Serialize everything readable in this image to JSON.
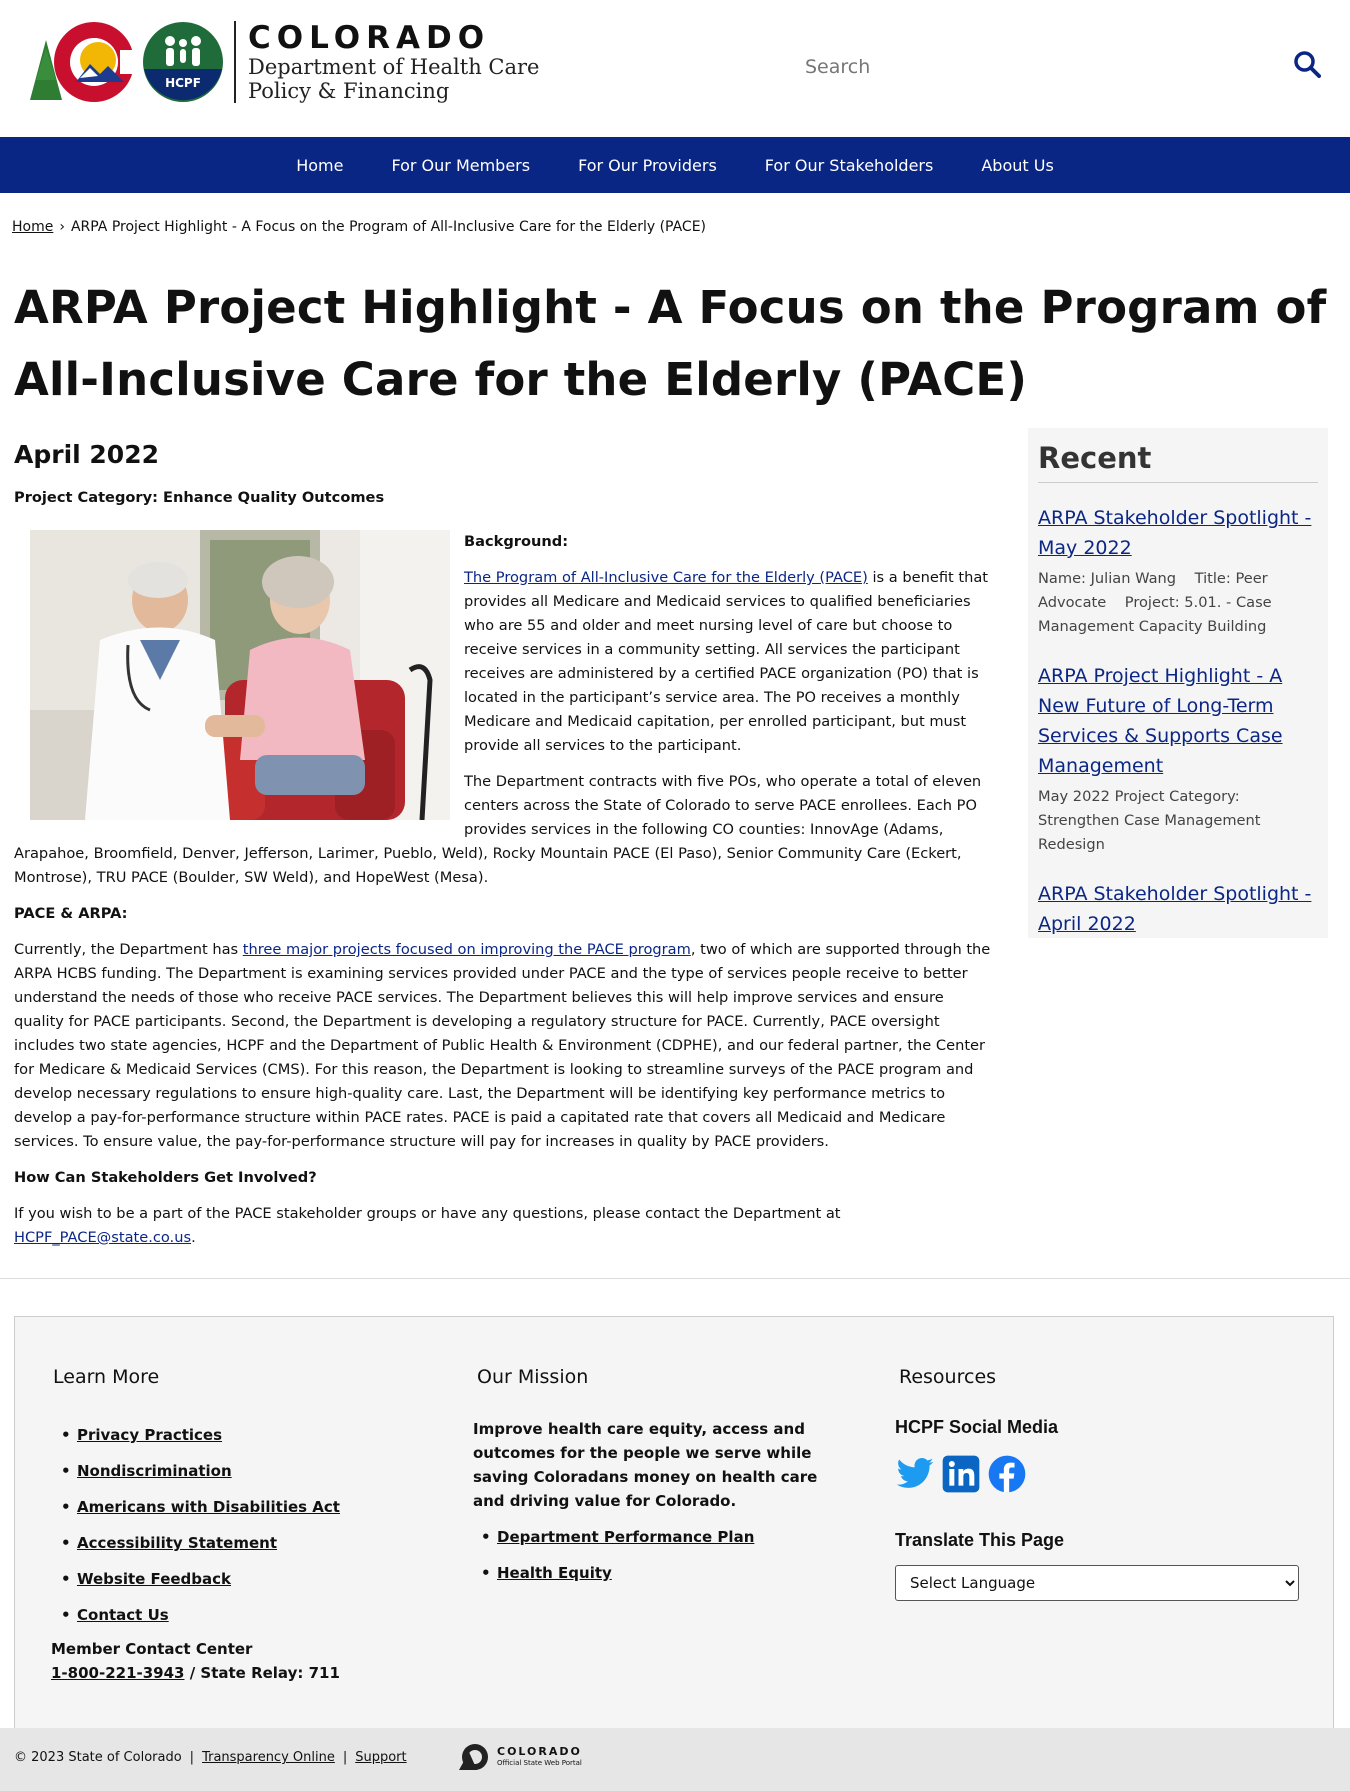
{
  "header": {
    "logo_state": "COLORADO",
    "logo_dept_line1": "Department of Health Care",
    "logo_dept_line2": "Policy & Financing",
    "hcpf_badge": "HCPF",
    "search_placeholder": "Search"
  },
  "nav": {
    "items": [
      {
        "label": "Home"
      },
      {
        "label": "For Our Members"
      },
      {
        "label": "For Our Providers"
      },
      {
        "label": "For Our Stakeholders"
      },
      {
        "label": "About Us"
      }
    ]
  },
  "breadcrumb": {
    "home": "Home",
    "separator": "›",
    "current": "ARPA Project Highlight - A Focus on the Program of All-Inclusive Care for the Elderly (PACE)"
  },
  "page": {
    "title": "ARPA Project Highlight - A Focus on the Program of All-Inclusive Care for the Elderly (PACE)",
    "date": "April 2022",
    "category": "Project Category: Enhance Quality Outcomes",
    "background_label": "Background:",
    "pace_link": "The Program of All-Inclusive Care for the Elderly (PACE)",
    "para1_rest": " is a benefit that provides all Medicare and Medicaid services to qualified beneficiaries who are 55 and older and meet nursing level of care but choose to receive services in a community setting. All services the participant receives are administered by a certified PACE organization (PO) that is located in the participant’s service area. The PO receives a monthly Medicare and Medicaid capitation, per enrolled participant, but must provide all services to the participant.",
    "para2": "The Department contracts with five POs, who operate a total of eleven centers across the State of Colorado to serve PACE enrollees. Each PO provides services in the following CO counties: InnovAge (Adams, Arapahoe, Broomfield, Denver, Jefferson, Larimer, Pueblo, Weld), Rocky Mountain PACE (El Paso), Senior Community Care (Eckert, Montrose), TRU PACE (Boulder, SW Weld), and HopeWest (Mesa).",
    "arpa_label": "PACE & ARPA:",
    "para3_start": "Currently, the Department has ",
    "projects_link": "three major projects focused on improving the PACE program",
    "para3_rest": ", two of which are supported through the ARPA HCBS funding. The Department is examining services provided under PACE and the type of services people receive to better understand the needs of those who receive PACE services. The Department believes this will help improve services and ensure quality for PACE participants. Second, the Department is developing a regulatory structure for PACE. Currently, PACE oversight includes two state agencies, HCPF and the Department of Public Health & Environment (CDPHE), and our federal partner, the Center for Medicare & Medicaid Services (CMS). For this reason, the Department is looking to streamline surveys of the PACE program and develop necessary regulations to ensure high-quality care. Last, the Department will be identifying key performance metrics to develop a pay-for-performance structure within PACE rates. PACE is paid a capitated rate that covers all Medicaid and Medicare services. To ensure value, the pay-for-performance structure will pay for increases in quality by PACE providers.",
    "involved_label": "How Can Stakeholders Get Involved?",
    "para4_start": "If you wish to be a part of the PACE stakeholder groups or have any questions, please contact the Department at ",
    "email": "HCPF_PACE@state.co.us",
    "para4_end": "."
  },
  "sidebar": {
    "title": "Recent",
    "items": [
      {
        "link": "ARPA Stakeholder Spotlight - May 2022",
        "meta": "Name: Julian Wang    Title: Peer Advocate    Project: 5.01. - Case Management Capacity Building"
      },
      {
        "link": "ARPA Project Highlight - A New Future of Long-Term Services & Supports Case Management",
        "meta": "May 2022 Project Category: Strengthen Case Management Redesign"
      },
      {
        "link": "ARPA Stakeholder Spotlight - April 2022",
        "meta": ""
      }
    ]
  },
  "footer": {
    "learn_more": {
      "title": "Learn More",
      "links": [
        "Privacy Practices",
        "Nondiscrimination",
        "Americans with Disabilities Act",
        "Accessibility Statement",
        "Website Feedback",
        "Contact Us"
      ]
    },
    "member": {
      "label": "Member Contact Center",
      "phone": "1-800-221-3943",
      "relay": " / State Relay: 711"
    },
    "mission": {
      "title": "Our Mission",
      "text": "Improve health care equity, access and outcomes for the people we serve while saving Coloradans money on health care and driving value for Colorado.",
      "links": [
        "Department Performance Plan",
        "Health Equity"
      ]
    },
    "resources": {
      "title": "Resources",
      "social_title": "HCPF Social Media",
      "translate_title": "Translate This Page",
      "select_value": "Select Language"
    }
  },
  "bottom": {
    "copyright": "© 2023 State of Colorado",
    "transparency": "Transparency Online",
    "support": "Support",
    "portal_line1": "COLORADO",
    "portal_line2": "Official State Web Portal"
  },
  "colors": {
    "nav_bg": "#0a2685",
    "link": "#0b2685",
    "twitter": "#1d9bf0",
    "linkedin": "#0a66c2",
    "facebook": "#1877f2"
  }
}
